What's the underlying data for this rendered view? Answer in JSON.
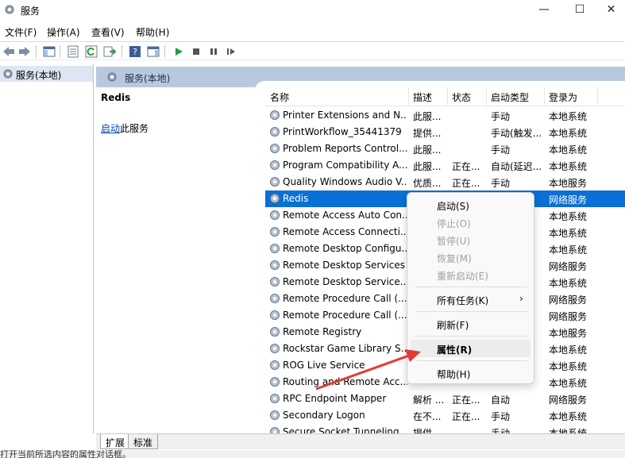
{
  "window": {
    "title": "服务",
    "minimize": "—",
    "maximize": "☐",
    "close": "✕"
  },
  "menubar": [
    "文件(F)",
    "操作(A)",
    "查看(V)",
    "帮助(H)"
  ],
  "toolbar": {
    "icons": [
      "back-arrow-icon",
      "forward-arrow-icon",
      "show-hide-console-tree-icon",
      "properties-icon",
      "refresh-icon",
      "export-list-icon",
      "help-icon",
      "show-hide-action-pane-icon",
      "start-service-icon",
      "stop-service-icon",
      "pause-service-icon",
      "resume-service-icon"
    ]
  },
  "tree": {
    "item_label": "服务(本地)"
  },
  "pane": {
    "header": "服务(本地)",
    "selected_service": "Redis",
    "start_link": "启动",
    "start_suffix": "此服务"
  },
  "columns": [
    "名称",
    "描述",
    "状态",
    "启动类型",
    "登录为"
  ],
  "services": [
    {
      "name": "Printer Extensions and N...",
      "desc": "此服...",
      "state": "",
      "type": "手动",
      "logon": "本地系统"
    },
    {
      "name": "PrintWorkflow_35441379",
      "desc": "提供...",
      "state": "",
      "type": "手动(触发...",
      "logon": "本地系统"
    },
    {
      "name": "Problem Reports Control...",
      "desc": "此服...",
      "state": "",
      "type": "手动",
      "logon": "本地系统"
    },
    {
      "name": "Program Compatibility A...",
      "desc": "此服...",
      "state": "正在...",
      "type": "自动(延迟...",
      "logon": "本地系统"
    },
    {
      "name": "Quality Windows Audio V...",
      "desc": "优质...",
      "state": "正在...",
      "type": "手动",
      "logon": "本地服务"
    },
    {
      "name": "Redis",
      "desc": "",
      "state": "",
      "type": "",
      "logon": "网络服务"
    },
    {
      "name": "Remote Access Auto Con...",
      "desc": "",
      "state": "",
      "type": "",
      "logon": "本地系统"
    },
    {
      "name": "Remote Access Connecti...",
      "desc": "",
      "state": "",
      "type": "",
      "logon": "本地系统"
    },
    {
      "name": "Remote Desktop Configu...",
      "desc": "",
      "state": "",
      "type": "",
      "logon": "本地系统"
    },
    {
      "name": "Remote Desktop Services",
      "desc": "",
      "state": "",
      "type": "",
      "logon": "网络服务"
    },
    {
      "name": "Remote Desktop Service...",
      "desc": "",
      "state": "",
      "type": "",
      "logon": "本地系统"
    },
    {
      "name": "Remote Procedure Call (...",
      "desc": "",
      "state": "",
      "type": "",
      "logon": "网络服务"
    },
    {
      "name": "Remote Procedure Call (...",
      "desc": "",
      "state": "",
      "type": "",
      "logon": "网络服务"
    },
    {
      "name": "Remote Registry",
      "desc": "",
      "state": "",
      "type": "",
      "logon": "本地服务"
    },
    {
      "name": "Rockstar Game Library S...",
      "desc": "",
      "state": "",
      "type": "",
      "logon": "本地系统"
    },
    {
      "name": "ROG Live Service",
      "desc": "",
      "state": "",
      "type": "",
      "logon": "本地系统"
    },
    {
      "name": "Routing and Remote Acc...",
      "desc": "",
      "state": "",
      "type": "",
      "logon": "本地系统"
    },
    {
      "name": "RPC Endpoint Mapper",
      "desc": "解析 ...",
      "state": "正在...",
      "type": "自动",
      "logon": "网络服务"
    },
    {
      "name": "Secondary Logon",
      "desc": "在不...",
      "state": "正在...",
      "type": "手动",
      "logon": "本地系统"
    },
    {
      "name": "Secure Socket Tunneling ...",
      "desc": "提供...",
      "state": "",
      "type": "手动",
      "logon": "本地系统"
    }
  ],
  "context_menu": {
    "items": [
      {
        "label": "启动(S)",
        "enabled": true
      },
      {
        "label": "停止(O)",
        "enabled": false
      },
      {
        "label": "暂停(U)",
        "enabled": false
      },
      {
        "label": "恢复(M)",
        "enabled": false
      },
      {
        "label": "重新启动(E)",
        "enabled": false
      },
      {
        "label": "所有任务(K)",
        "enabled": true,
        "submenu": true
      },
      {
        "label": "刷新(F)",
        "enabled": true
      },
      {
        "label": "属性(R)",
        "enabled": true,
        "highlighted": true
      },
      {
        "label": "帮助(H)",
        "enabled": true
      }
    ],
    "submenu_arrow": "›"
  },
  "tabs": [
    "扩展",
    "标准"
  ],
  "statusbar": {
    "text": "打开当前所选内容的属性对话框。"
  },
  "colors": {
    "selection": "#0a6fd6",
    "header": "#b8c9df",
    "link": "#0645ad",
    "annotation_arrow": "#e53935"
  }
}
